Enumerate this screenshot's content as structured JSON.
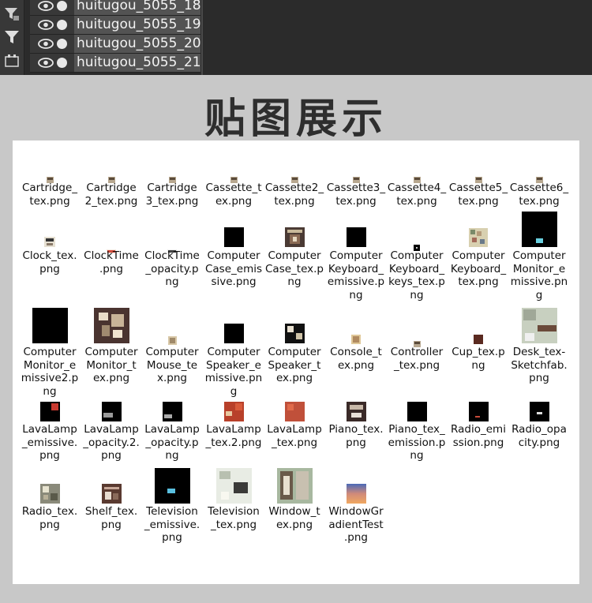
{
  "layers_panel": {
    "layers": [
      {
        "name": "huitugou_5055_18"
      },
      {
        "name": "huitugou_5055_19"
      },
      {
        "name": "huitugou_5055_20"
      },
      {
        "name": "huitugou_5055_21"
      }
    ],
    "tools": [
      "filter-adjust-icon",
      "filter-icon",
      "artboard-icon"
    ]
  },
  "title": "贴图展示",
  "files": [
    {
      "label": "Cartridge_\ntex.png",
      "thumb": "tiny"
    },
    {
      "label": "Cartridge\n2_tex.png",
      "thumb": "tiny"
    },
    {
      "label": "Cartridge\n3_tex.png",
      "thumb": "tiny"
    },
    {
      "label": "Cassette_t\nex.png",
      "thumb": "tiny"
    },
    {
      "label": "Cassette2_\ntex.png",
      "thumb": "tiny"
    },
    {
      "label": "Cassette3_\ntex.png",
      "thumb": "tiny"
    },
    {
      "label": "Cassette4_\ntex.png",
      "thumb": "tiny"
    },
    {
      "label": "Cassette5_\ntex.png",
      "thumb": "tiny"
    },
    {
      "label": "Cassette6_\ntex.png",
      "thumb": "tiny"
    },
    {
      "label": "Clock_tex.\npng",
      "thumb": "small-pattern"
    },
    {
      "label": "ClockTime\n.png",
      "thumb": "tiny-red"
    },
    {
      "label": "ClockTime\n_opacity.p\nng",
      "thumb": "tiny-dark"
    },
    {
      "label": "Computer\nCase_emis\nsive.png",
      "thumb": "black-tall"
    },
    {
      "label": "Computer\nCase_tex.p\nng",
      "thumb": "brown-pattern"
    },
    {
      "label": "Computer\nKeyboard_\nemissive.p\nng",
      "thumb": "black-tall"
    },
    {
      "label": "Computer\nKeyboard_\nkeys_tex.p\nng",
      "thumb": "black-small"
    },
    {
      "label": "Computer\nKeyboard_\ntex.png",
      "thumb": "checker"
    },
    {
      "label": "Computer\nMonitor_e\nmissive.pn\ng",
      "thumb": "black-big"
    },
    {
      "label": "Computer\nMonitor_e\nmissive2.p\nng",
      "thumb": "black-large"
    },
    {
      "label": "Computer\nMonitor_t\nex.png",
      "thumb": "brown-large"
    },
    {
      "label": "Computer\nMouse_te\nx.png",
      "thumb": "tiny-beige"
    },
    {
      "label": "Computer\nSpeaker_e\nmissive.pn\ng",
      "thumb": "black-mid"
    },
    {
      "label": "Computer\nSpeaker_t\nex.png",
      "thumb": "speaker"
    },
    {
      "label": "Console_t\nex.png",
      "thumb": "tiny-beige2"
    },
    {
      "label": "Controller\n_tex.png",
      "thumb": "tiny"
    },
    {
      "label": "Cup_tex.p\nng",
      "thumb": "tiny-brown"
    },
    {
      "label": "Desk_tex-\nSketchfab.\npng",
      "thumb": "desk"
    },
    {
      "label": "LavaLamp\n_emissive.\npng",
      "thumb": "lava-red"
    },
    {
      "label": "LavaLamp\n_opacity.2.\npng",
      "thumb": "lava-grey"
    },
    {
      "label": "LavaLamp\n_opacity.p\nng",
      "thumb": "lava-grey2"
    },
    {
      "label": "LavaLamp\n_tex.2.png",
      "thumb": "lava-orange"
    },
    {
      "label": "LavaLamp\n_tex.png",
      "thumb": "lava-orange2"
    },
    {
      "label": "Piano_tex.\npng",
      "thumb": "piano"
    },
    {
      "label": "Piano_tex_\nemission.p\nng",
      "thumb": "black-mid2"
    },
    {
      "label": "Radio_emi\nssion.png",
      "thumb": "radio-em"
    },
    {
      "label": "Radio_opa\ncity.png",
      "thumb": "radio-op"
    },
    {
      "label": "Radio_tex.\npng",
      "thumb": "radio"
    },
    {
      "label": "Shelf_tex.\npng",
      "thumb": "shelf"
    },
    {
      "label": "Television\n_emissive.\npng",
      "thumb": "tv-em"
    },
    {
      "label": "Television\n_tex.png",
      "thumb": "tv"
    },
    {
      "label": "Window_t\nex.png",
      "thumb": "window"
    },
    {
      "label": "WindowGr\nadientTest\n.png",
      "thumb": "gradient"
    }
  ]
}
